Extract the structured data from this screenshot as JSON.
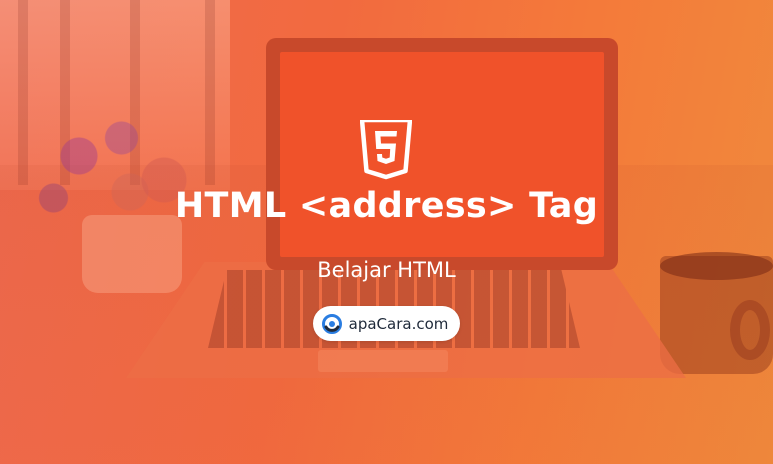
{
  "banner": {
    "title": "HTML <address> Tag",
    "subtitle": "Belajar HTML",
    "brand_label": "apaCara.com",
    "badge_icon": "html5-logo-icon",
    "brand_icon": "apacara-logo-icon",
    "background_scene": "laptop-on-table-with-flowers-and-coffee-cup",
    "colors": {
      "overlay_gradient_start": "#ef6a4f",
      "overlay_gradient_end": "#f08a3c",
      "text": "#ffffff",
      "pill_background": "#ffffff",
      "pill_text": "#1f2a3a",
      "brand_logo_blue": "#2a7de1"
    }
  }
}
